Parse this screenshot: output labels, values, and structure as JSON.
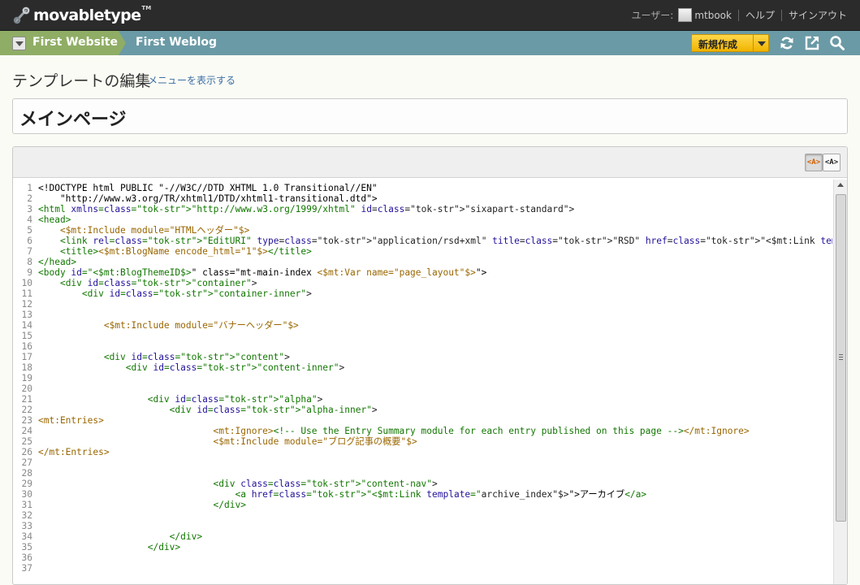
{
  "app": {
    "logo_text": "movabletype",
    "logo_tm": "TM"
  },
  "usernav": {
    "user_label": "ユーザー:",
    "username": "mtbook",
    "help": "ヘルプ",
    "signout": "サインアウト"
  },
  "context": {
    "website": "First Website",
    "blog": "First Weblog",
    "new_button": "新規作成",
    "icons": [
      "refresh-icon",
      "external-link-icon",
      "search-icon"
    ]
  },
  "page": {
    "title": "テンプレートの編集",
    "show_menu": "メニューを表示する",
    "template_name": "メインページ"
  },
  "editor": {
    "highlight_on_label": "<A>",
    "highlight_off_label": "<A>",
    "lines": [
      "<!DOCTYPE html PUBLIC \"-//W3C//DTD XHTML 1.0 Transitional//EN\"",
      "    \"http://www.w3.org/TR/xhtml1/DTD/xhtml1-transitional.dtd\">",
      "<html xmlns=\"http://www.w3.org/1999/xhtml\" id=\"sixapart-standard\">",
      "<head>",
      "    <$mt:Include module=\"HTMLヘッダー\"$>",
      "    <link rel=\"EditURI\" type=\"application/rsd+xml\" title=\"RSD\" href=\"<$mt:Link template=\"rsd\"$>\" />",
      "    <title><$mt:BlogName encode_html=\"1\"$></title>",
      "</head>",
      "<body id=\"<$mt:BlogThemeID$>\" class=\"mt-main-index <$mt:Var name=\"page_layout\"$>\">",
      "    <div id=\"container\">",
      "        <div id=\"container-inner\">",
      "",
      "",
      "            <$mt:Include module=\"バナーヘッダー\"$>",
      "",
      "",
      "            <div id=\"content\">",
      "                <div id=\"content-inner\">",
      "",
      "",
      "                    <div id=\"alpha\">",
      "                        <div id=\"alpha-inner\">",
      "<mt:Entries>",
      "                                <mt:Ignore><!-- Use the Entry Summary module for each entry published on this page --></mt:Ignore>",
      "                                <$mt:Include module=\"ブログ記事の概要\"$>",
      "</mt:Entries>",
      "",
      "",
      "                                <div class=\"content-nav\">",
      "                                    <a href=\"<$mt:Link template=\"archive_index\"$>\">アーカイブ</a>",
      "                                </div>",
      "",
      "",
      "                        </div>",
      "                    </div>",
      "",
      ""
    ]
  },
  "colors": {
    "topbar": "#2b2b2b",
    "context_bar": "#6a9aa6",
    "website_tab": "#8fad65",
    "new_button": "#f5c400",
    "link": "#3b6fa5"
  }
}
